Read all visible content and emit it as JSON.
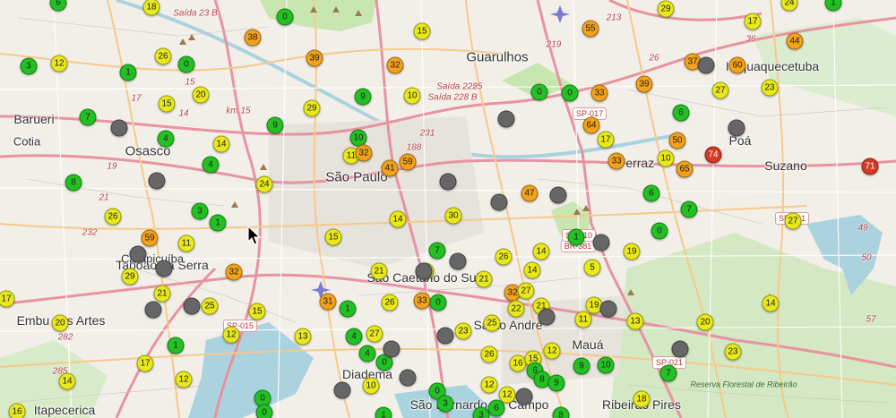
{
  "places": [
    {
      "name": "Guarulhos",
      "size": "big"
    },
    {
      "name": "São Paulo",
      "size": "big"
    },
    {
      "name": "Osasco",
      "size": "big"
    },
    {
      "name": "Barueri",
      "size": "normal"
    },
    {
      "name": "Suzano",
      "size": "normal"
    },
    {
      "name": "Poá",
      "size": "normal"
    },
    {
      "name": "Diadema",
      "size": "normal"
    },
    {
      "name": "Mauá",
      "size": "normal"
    },
    {
      "name": "Ribeirão Pires",
      "size": "normal"
    },
    {
      "name": "Itapecerica",
      "size": "normal"
    },
    {
      "name": "Embu das Artes",
      "size": "normal"
    },
    {
      "name": "Taboão da Serra",
      "size": "normal"
    },
    {
      "name": "São Caetano do Sul",
      "size": "normal"
    },
    {
      "name": "Santo André",
      "size": "normal"
    },
    {
      "name": "São Bernardo do Campo",
      "size": "normal"
    },
    {
      "name": "Ferraz",
      "size": "normal"
    },
    {
      "name": "Itaquaquecetuba",
      "size": "normal"
    },
    {
      "name": "Cotia",
      "size": "small"
    },
    {
      "name": "Carapicuíba",
      "size": "small"
    }
  ],
  "road_labels": [
    "Saída 23 B",
    "km 15",
    "Saída 225",
    "Saída 228 B",
    "188",
    "231",
    "219",
    "225",
    "213",
    "36",
    "26",
    "14",
    "15",
    "17",
    "19",
    "21",
    "282",
    "285",
    "49",
    "50",
    "57",
    "232"
  ],
  "shields": [
    "SP-017",
    "SP-015",
    "SP-021",
    "SP-031",
    "BR-381",
    "SP-010"
  ],
  "reserve_label": "Reserva Florestal de Ribeirão",
  "air_quality_markers": [
    {
      "label": "0",
      "level": "good"
    },
    {
      "label": "18",
      "level": "moderate"
    },
    {
      "label": "29",
      "level": "moderate"
    },
    {
      "label": "24",
      "level": "moderate"
    },
    {
      "label": "38",
      "level": "poor"
    },
    {
      "label": "15",
      "level": "moderate"
    },
    {
      "label": "55",
      "level": "poor"
    },
    {
      "label": "3",
      "level": "good"
    },
    {
      "label": "26",
      "level": "moderate"
    },
    {
      "label": "0",
      "level": "good"
    },
    {
      "label": "39",
      "level": "poor"
    },
    {
      "label": "32",
      "level": "poor"
    },
    {
      "label": "37",
      "level": "poor"
    },
    {
      "label": "60",
      "level": "poor"
    },
    {
      "label": "44",
      "level": "poor"
    },
    {
      "label": "20",
      "level": "moderate"
    },
    {
      "label": "9",
      "level": "good"
    },
    {
      "label": "10",
      "level": "moderate"
    },
    {
      "label": "0",
      "level": "good"
    },
    {
      "label": "0",
      "level": "good"
    },
    {
      "label": "33",
      "level": "poor"
    },
    {
      "label": "39",
      "level": "poor"
    },
    {
      "label": "27",
      "level": "moderate"
    },
    {
      "label": "23",
      "level": "moderate"
    },
    {
      "label": "15",
      "level": "moderate"
    },
    {
      "label": "7",
      "level": "good"
    },
    {
      "label": "29",
      "level": "moderate"
    },
    {
      "label": "9",
      "level": "good"
    },
    {
      "label": "6",
      "level": "good"
    },
    {
      "label": "64",
      "level": "poor"
    },
    {
      "label": "4",
      "level": "good"
    },
    {
      "label": "14",
      "level": "moderate"
    },
    {
      "label": "10",
      "level": "good"
    },
    {
      "label": "11",
      "level": "moderate"
    },
    {
      "label": "32",
      "level": "poor"
    },
    {
      "label": "59",
      "level": "poor"
    },
    {
      "label": "41",
      "level": "poor"
    },
    {
      "label": "17",
      "level": "moderate"
    },
    {
      "label": "50",
      "level": "poor"
    },
    {
      "label": "10",
      "level": "moderate"
    },
    {
      "label": "65",
      "level": "poor"
    },
    {
      "label": "74",
      "level": "unhealthy"
    },
    {
      "label": "71",
      "level": "unhealthy"
    },
    {
      "label": "33",
      "level": "poor"
    },
    {
      "label": "4",
      "level": "good"
    },
    {
      "label": "8",
      "level": "good"
    },
    {
      "label": "24",
      "level": "moderate"
    },
    {
      "label": "6",
      "level": "good"
    },
    {
      "label": "47",
      "level": "poor"
    },
    {
      "label": "7",
      "level": "good"
    },
    {
      "label": "26",
      "level": "moderate"
    },
    {
      "label": "3",
      "level": "good"
    },
    {
      "label": "1",
      "level": "good"
    },
    {
      "label": "14",
      "level": "moderate"
    },
    {
      "label": "30",
      "level": "moderate"
    },
    {
      "label": "27",
      "level": "moderate"
    },
    {
      "label": "59",
      "level": "poor"
    },
    {
      "label": "11",
      "level": "moderate"
    },
    {
      "label": "15",
      "level": "moderate"
    },
    {
      "label": "1",
      "level": "good"
    },
    {
      "label": "0",
      "level": "good"
    },
    {
      "label": "7",
      "level": "good"
    },
    {
      "label": "14",
      "level": "moderate"
    },
    {
      "label": "19",
      "level": "moderate"
    },
    {
      "label": "29",
      "level": "moderate"
    },
    {
      "label": "32",
      "level": "poor"
    },
    {
      "label": "21",
      "level": "moderate"
    },
    {
      "label": "21",
      "level": "moderate"
    },
    {
      "label": "44",
      "level": "moderate"
    },
    {
      "label": "26",
      "level": "moderate"
    },
    {
      "label": "14",
      "level": "moderate"
    },
    {
      "label": "5",
      "level": "moderate"
    },
    {
      "label": "17",
      "level": "moderate"
    },
    {
      "label": "21",
      "level": "moderate"
    },
    {
      "label": "25",
      "level": "moderate"
    },
    {
      "label": "15",
      "level": "moderate"
    },
    {
      "label": "31",
      "level": "poor"
    },
    {
      "label": "1",
      "level": "good"
    },
    {
      "label": "26",
      "level": "moderate"
    },
    {
      "label": "33",
      "level": "poor"
    },
    {
      "label": "0",
      "level": "good"
    },
    {
      "label": "32",
      "level": "poor"
    },
    {
      "label": "27",
      "level": "moderate"
    },
    {
      "label": "22",
      "level": "moderate"
    },
    {
      "label": "21",
      "level": "moderate"
    },
    {
      "label": "19",
      "level": "moderate"
    },
    {
      "label": "11",
      "level": "moderate"
    },
    {
      "label": "13",
      "level": "moderate"
    },
    {
      "label": "14",
      "level": "moderate"
    },
    {
      "label": "20",
      "level": "moderate"
    },
    {
      "label": "12",
      "level": "moderate"
    },
    {
      "label": "13",
      "level": "moderate"
    },
    {
      "label": "4",
      "level": "good"
    },
    {
      "label": "27",
      "level": "moderate"
    },
    {
      "label": "25",
      "level": "moderate"
    },
    {
      "label": "23",
      "level": "moderate"
    },
    {
      "label": "20",
      "level": "moderate"
    },
    {
      "label": "23",
      "level": "moderate"
    },
    {
      "label": "1",
      "level": "good"
    },
    {
      "label": "12",
      "level": "moderate"
    },
    {
      "label": "4",
      "level": "good"
    },
    {
      "label": "0",
      "level": "good"
    },
    {
      "label": "26",
      "level": "moderate"
    },
    {
      "label": "16",
      "level": "moderate"
    },
    {
      "label": "15",
      "level": "moderate"
    },
    {
      "label": "12",
      "level": "moderate"
    },
    {
      "label": "9",
      "level": "good"
    },
    {
      "label": "10",
      "level": "good"
    },
    {
      "label": "7",
      "level": "good"
    },
    {
      "label": "6",
      "level": "good"
    },
    {
      "label": "8",
      "level": "good"
    },
    {
      "label": "9",
      "level": "good"
    },
    {
      "label": "14",
      "level": "moderate"
    },
    {
      "label": "17",
      "level": "moderate"
    },
    {
      "label": "0",
      "level": "good"
    },
    {
      "label": "12",
      "level": "moderate"
    },
    {
      "label": "12",
      "level": "moderate"
    },
    {
      "label": "18",
      "level": "moderate"
    },
    {
      "label": "10",
      "level": "moderate"
    },
    {
      "label": "0",
      "level": "good"
    },
    {
      "label": "0",
      "level": "good"
    },
    {
      "label": "1",
      "level": "good"
    },
    {
      "label": "3",
      "level": "good"
    },
    {
      "label": "6",
      "level": "good"
    },
    {
      "label": "8",
      "level": "good"
    },
    {
      "label": "16",
      "level": "moderate"
    },
    {
      "label": "3",
      "level": "good"
    },
    {
      "label": "6",
      "level": "good"
    },
    {
      "label": "1",
      "level": "good"
    },
    {
      "label": "17",
      "level": "moderate"
    },
    {
      "label": "12",
      "level": "moderate"
    },
    {
      "label": "1",
      "level": "good"
    },
    {
      "label": "",
      "level": "none"
    },
    {
      "label": "",
      "level": "none"
    },
    {
      "label": "",
      "level": "none"
    },
    {
      "label": "",
      "level": "none"
    },
    {
      "label": "",
      "level": "none"
    },
    {
      "label": "",
      "level": "none"
    },
    {
      "label": "",
      "level": "none"
    },
    {
      "label": "",
      "level": "none"
    },
    {
      "label": "",
      "level": "none"
    },
    {
      "label": "",
      "level": "none"
    },
    {
      "label": "",
      "level": "none"
    },
    {
      "label": "",
      "level": "none"
    },
    {
      "label": "",
      "level": "none"
    },
    {
      "label": "",
      "level": "none"
    },
    {
      "label": "",
      "level": "none"
    },
    {
      "label": "",
      "level": "none"
    },
    {
      "label": "",
      "level": "none"
    },
    {
      "label": "",
      "level": "none"
    },
    {
      "label": "",
      "level": "none"
    },
    {
      "label": "",
      "level": "none"
    },
    {
      "label": "",
      "level": "none"
    },
    {
      "label": "",
      "level": "none"
    },
    {
      "label": "",
      "level": "none"
    },
    {
      "label": "",
      "level": "none"
    },
    {
      "label": "",
      "level": "none"
    },
    {
      "label": "",
      "level": "none"
    },
    {
      "label": "",
      "level": "none"
    },
    {
      "label": "",
      "level": "none"
    },
    {
      "label": "",
      "level": "none"
    },
    {
      "label": "",
      "level": "none"
    }
  ],
  "level_colors": {
    "good": "#22c022",
    "moderate": "#e8e81a",
    "poor": "#f2a11a",
    "unhealthy": "#d23a23",
    "none": "#666666"
  }
}
